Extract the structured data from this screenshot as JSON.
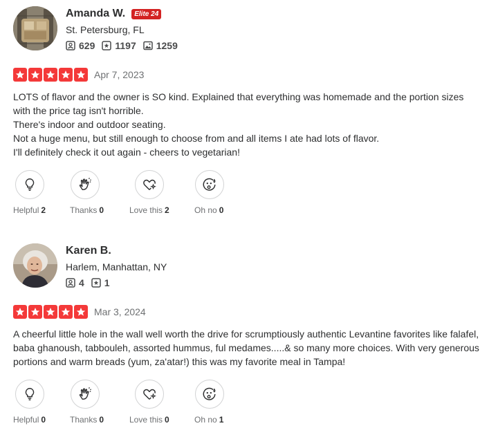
{
  "colors": {
    "star_red": "#f43939",
    "elite_red": "#d32323",
    "text": "#2d2e2f",
    "muted": "#6e7072"
  },
  "reviews": [
    {
      "user": {
        "name": "Amanda W.",
        "badge": "Elite 24",
        "location": "St. Petersburg, FL",
        "friends": "629",
        "reviews": "1197",
        "photos": "1259"
      },
      "rating": 5,
      "date": "Apr 7, 2023",
      "lines": [
        "LOTS of flavor and the owner is SO kind. Explained that everything was homemade and the portion sizes with the price tag isn't horrible.",
        "There's indoor and outdoor seating.",
        "Not a huge menu, but still enough to choose from and all items I ate had lots of flavor.",
        "I'll definitely check it out again - cheers to vegetarian!"
      ],
      "reactions": [
        {
          "icon": "lightbulb-icon",
          "label": "Helpful",
          "count": "2"
        },
        {
          "icon": "clapping-hand-icon",
          "label": "Thanks",
          "count": "0"
        },
        {
          "icon": "heart-sparkle-icon",
          "label": "Love this",
          "count": "2"
        },
        {
          "icon": "surprised-face-icon",
          "label": "Oh no",
          "count": "0"
        }
      ]
    },
    {
      "user": {
        "name": "Karen B.",
        "location": "Harlem, Manhattan, NY",
        "friends": "4",
        "reviews": "1"
      },
      "rating": 5,
      "date": "Mar 3, 2024",
      "lines": [
        "A cheerful little hole in the wall well worth the drive for scrumptiously authentic Levantine favorites like falafel, baba ghanoush, tabbouleh, assorted hummus, ful medames.....& so many more choices. With very generous portions and warm breads (yum, za'atar!) this was my favorite meal in Tampa!"
      ],
      "reactions": [
        {
          "icon": "lightbulb-icon",
          "label": "Helpful",
          "count": "0"
        },
        {
          "icon": "clapping-hand-icon",
          "label": "Thanks",
          "count": "0"
        },
        {
          "icon": "heart-sparkle-icon",
          "label": "Love this",
          "count": "0"
        },
        {
          "icon": "surprised-face-icon",
          "label": "Oh no",
          "count": "1"
        }
      ]
    }
  ]
}
